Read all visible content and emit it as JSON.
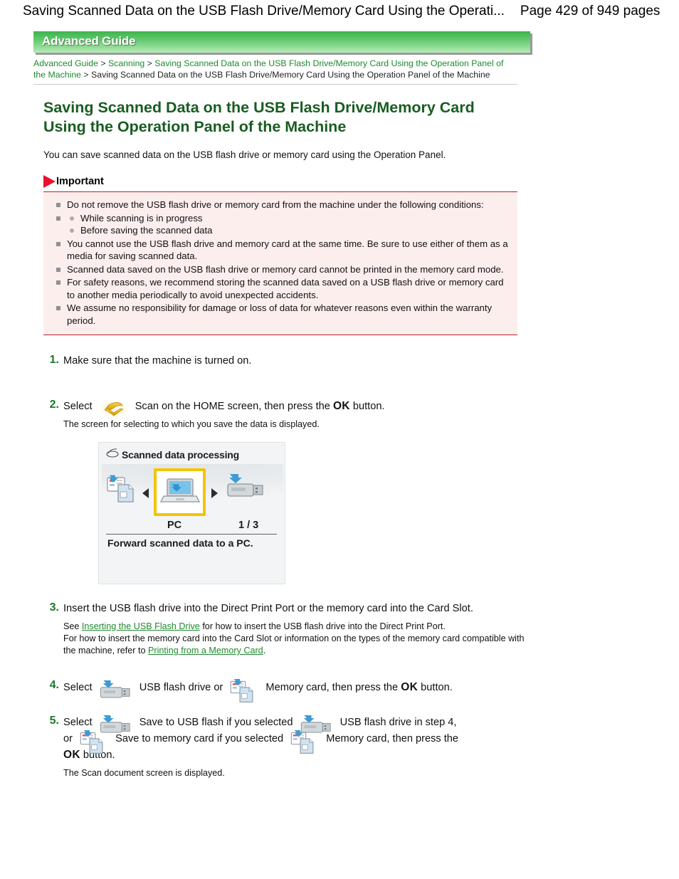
{
  "page_header": {
    "title": "Saving Scanned Data on the USB Flash Drive/Memory Card Using the Operati...",
    "page_count": "Page 429 of 949 pages"
  },
  "banner": {
    "label": "Advanced Guide",
    "color": "#3cb44b"
  },
  "breadcrumb": {
    "item1": "Advanced Guide",
    "sep1": ">",
    "item2": "Scanning",
    "sep2": ">",
    "item3": "Saving Scanned Data on the USB Flash Drive/Memory Card Using the Operation Panel of the Machine",
    "sep3": ">",
    "current": "Saving Scanned Data on the USB Flash Drive/Memory Card Using the Operation Panel of the Machine"
  },
  "doc": {
    "title": "Saving Scanned Data on the USB Flash Drive/Memory Card Using the Operation Panel of the Machine",
    "intro": "You can save scanned data on the USB flash drive or memory card using the Operation Panel."
  },
  "important": {
    "label": "Important",
    "icon": "red-flag-icon",
    "accent_color": "#b5202a",
    "background": "#fdeeee",
    "items": [
      "Do not remove the USB flash drive or memory card from the machine under the following conditions:",
      "You cannot use the USB flash drive and memory card at the same time. Be sure to use either of them as a media for saving scanned data.",
      "Scanned data saved on the USB flash drive or memory card cannot be printed in the memory card mode.",
      "For safety reasons, we recommend storing the scanned data saved on a USB flash drive or memory card to another media periodically to avoid unexpected accidents.",
      "We assume no responsibility for damage or loss of data for whatever reasons even within the warranty period."
    ],
    "subitems": [
      "While scanning is in progress",
      "Before saving the scanned data"
    ]
  },
  "steps": {
    "step1": {
      "num": "1.",
      "text": "Make sure that the machine is turned on."
    },
    "step2": {
      "num": "2.",
      "select": "Select",
      "icon": "scan-icon",
      "text_a": "Scan on the HOME screen, then press the",
      "ok": "OK",
      "text_b": "button.",
      "note": "The screen for selecting to which you save the data is displayed."
    },
    "step3": {
      "num": "3.",
      "text": "Insert the USB flash drive into the Direct Print Port or the memory card into the Card Slot.",
      "note_a": "See",
      "link_a": "Inserting the USB Flash Drive",
      "note_b": "for how to insert the USB flash drive into the Direct Print Port.",
      "note_c": "For how to insert the memory card into the Card Slot or information on the types of the memory card compatible with the machine, refer to",
      "link_b": "Printing from a Memory Card",
      "note_d": "."
    },
    "step4": {
      "num": "4.",
      "select": "Select",
      "usb_label": "USB flash drive or",
      "card_label": "Memory card, then press the",
      "ok": "OK",
      "tail": "button."
    },
    "step5": {
      "num": "5.",
      "select": "Select",
      "usb_label": "Save to USB flash if you selected",
      "usb_label2": "USB flash drive in step 4,",
      "or": "or",
      "card_label": "Save to memory card if you selected",
      "card_label2": "Memory card, then press the",
      "ok": "OK",
      "tail": "button.",
      "note": "The Scan document screen is displayed."
    }
  },
  "lcd": {
    "title": "Scanned data processing",
    "title_icon": "scanner-icon",
    "selected_label": "PC",
    "pager": "1 / 3",
    "description": "Forward scanned data to a PC.",
    "left_icon": "memory-card-icon",
    "center_icon": "pc-laptop-icon",
    "right_icon": "usb-flash-drive-icon",
    "highlight_color": "#f2c500"
  }
}
